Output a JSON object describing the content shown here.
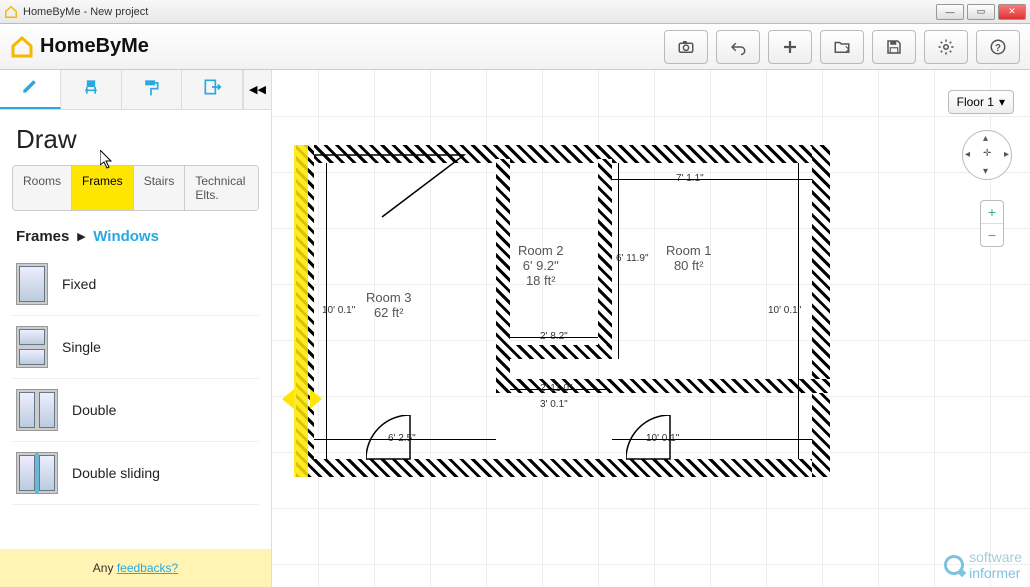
{
  "window": {
    "title": "HomeByMe - New project"
  },
  "app": {
    "name": "HomeByMe"
  },
  "toolbar": {
    "camera": "Camera",
    "undo": "Undo",
    "add": "Add",
    "openfolder": "Open",
    "save": "Save",
    "settings": "Settings",
    "help": "Help"
  },
  "sidebar": {
    "heading": "Draw",
    "subtabs": [
      "Rooms",
      "Frames",
      "Stairs",
      "Technical Elts."
    ],
    "subtab_active": 1,
    "breadcrumb_root": "Frames",
    "breadcrumb_leaf": "Windows",
    "items": [
      {
        "label": "Fixed"
      },
      {
        "label": "Single"
      },
      {
        "label": "Double"
      },
      {
        "label": "Double sliding"
      }
    ],
    "feedback_prefix": "Any ",
    "feedback_link": "feedbacks?"
  },
  "canvas": {
    "floor_label": "Floor 1",
    "rooms": [
      {
        "name": "Room 1",
        "area": "80 ft²"
      },
      {
        "name": "Room 2",
        "dim": "6' 9.2\"",
        "area": "18 ft²"
      },
      {
        "name": "Room 3",
        "area": "62 ft²"
      }
    ],
    "dimensions": {
      "top_right": "7' 1.1\"",
      "right_upper": "6' 11.9\"",
      "right_outer": "10' 0.1\"",
      "left_outer": "10' 0.1\"",
      "mid_lower1": "2' 8.2\"",
      "mid_lower2": "2' 11.0\"",
      "mid_lower3": "3' 0.1\"",
      "bottom_right_door": "10' 0.1\"",
      "bottom_left_door": "6' 2.5\""
    }
  },
  "watermark": {
    "line1": "software",
    "line2": "informer"
  }
}
